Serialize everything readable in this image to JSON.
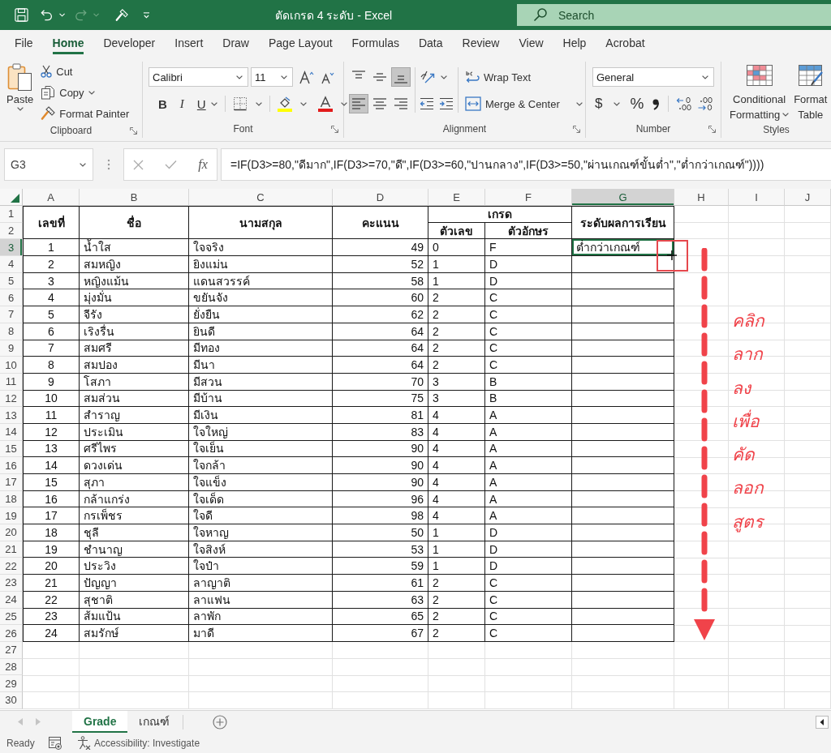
{
  "title_bar": {
    "title": "ตัดเกรด 4 ระดับ - Excel",
    "search": {
      "placeholder": "Search"
    }
  },
  "ribbon_tabs": [
    {
      "label": "File",
      "selected": false
    },
    {
      "label": "Home",
      "selected": true
    },
    {
      "label": "Developer",
      "selected": false
    },
    {
      "label": "Insert",
      "selected": false
    },
    {
      "label": "Draw",
      "selected": false
    },
    {
      "label": "Page Layout",
      "selected": false
    },
    {
      "label": "Formulas",
      "selected": false
    },
    {
      "label": "Data",
      "selected": false
    },
    {
      "label": "Review",
      "selected": false
    },
    {
      "label": "View",
      "selected": false
    },
    {
      "label": "Help",
      "selected": false
    },
    {
      "label": "Acrobat",
      "selected": false
    }
  ],
  "clipboard": {
    "paste": "Paste",
    "cut": "Cut",
    "copy": "Copy",
    "format_painter": "Format Painter",
    "group_label": "Clipboard"
  },
  "font": {
    "font_name": "Calibri",
    "font_size": "11",
    "styles": [
      {
        "kind": "bold",
        "label": "B"
      },
      {
        "kind": "italic",
        "label": "I"
      },
      {
        "kind": "underline",
        "label": "U"
      }
    ],
    "group_label": "Font"
  },
  "alignment": {
    "vertical": [
      {
        "kind": "top",
        "selected": false
      },
      {
        "kind": "middle",
        "selected": false
      },
      {
        "kind": "bottom",
        "selected": true
      }
    ],
    "horizontal": [
      {
        "kind": "left",
        "selected": true
      },
      {
        "kind": "center",
        "selected": false
      },
      {
        "kind": "right",
        "selected": false
      }
    ],
    "wrap_text": "Wrap Text",
    "merge_center": "Merge & Center",
    "group_label": "Alignment"
  },
  "number": {
    "format": "General",
    "currency": "$",
    "percent": "%",
    "group_label": "Number"
  },
  "styles": {
    "conditional_formatting": [
      "Conditional",
      "Formatting"
    ],
    "format_as_table": [
      "Format",
      "Table"
    ],
    "group_label": "Styles"
  },
  "formula_bar": {
    "name_box": "G3",
    "function_label": "fx",
    "formula": "=IF(D3>=80,\"ดีมาก\",IF(D3>=70,\"ดี\",IF(D3>=60,\"ปานกลาง\",IF(D3>=50,\"ผ่านเกณฑ์ขั้นต่ำ\",\"ต่ำกว่าเกณฑ์\"))))"
  },
  "sheet": {
    "columns": [
      {
        "label": "A",
        "selected": false
      },
      {
        "label": "B",
        "selected": false
      },
      {
        "label": "C",
        "selected": false
      },
      {
        "label": "D",
        "selected": false
      },
      {
        "label": "E",
        "selected": false
      },
      {
        "label": "F",
        "selected": false
      },
      {
        "label": "G",
        "selected": true
      },
      {
        "label": "H",
        "selected": false
      },
      {
        "label": "I",
        "selected": false
      },
      {
        "label": "J",
        "selected": false
      }
    ],
    "row_numbers": [
      {
        "label": "1",
        "selected": false
      },
      {
        "label": "2",
        "selected": false
      },
      {
        "label": "3",
        "selected": true
      },
      {
        "label": "4",
        "selected": false
      },
      {
        "label": "5",
        "selected": false
      },
      {
        "label": "6",
        "selected": false
      },
      {
        "label": "7",
        "selected": false
      },
      {
        "label": "8",
        "selected": false
      },
      {
        "label": "9",
        "selected": false
      },
      {
        "label": "10",
        "selected": false
      },
      {
        "label": "11",
        "selected": false
      },
      {
        "label": "12",
        "selected": false
      },
      {
        "label": "13",
        "selected": false
      },
      {
        "label": "14",
        "selected": false
      },
      {
        "label": "15",
        "selected": false
      },
      {
        "label": "16",
        "selected": false
      },
      {
        "label": "17",
        "selected": false
      },
      {
        "label": "18",
        "selected": false
      },
      {
        "label": "19",
        "selected": false
      },
      {
        "label": "20",
        "selected": false
      },
      {
        "label": "21",
        "selected": false
      },
      {
        "label": "22",
        "selected": false
      },
      {
        "label": "23",
        "selected": false
      },
      {
        "label": "24",
        "selected": false
      },
      {
        "label": "25",
        "selected": false
      },
      {
        "label": "26",
        "selected": false
      },
      {
        "label": "27",
        "selected": false
      },
      {
        "label": "28",
        "selected": false
      },
      {
        "label": "29",
        "selected": false
      },
      {
        "label": "30",
        "selected": false
      }
    ],
    "header": {
      "no": "เลขที่",
      "first_name": "ชื่อ",
      "last_name": "นามสกุล",
      "score": "คะแนน",
      "grade": "เกรด",
      "grade_number": "ตัวเลข",
      "grade_letter": "ตัวอักษร",
      "level": "ระดับผลการเรียน"
    },
    "rows": [
      {
        "no": "1",
        "first_name": "น้ำใส",
        "last_name": "ใจจริง",
        "score": "49",
        "grade_number": "0",
        "grade_letter": "F",
        "level": "ต่ำกว่าเกณฑ์"
      },
      {
        "no": "2",
        "first_name": "สมหญิง",
        "last_name": "ยิงแม่น",
        "score": "52",
        "grade_number": "1",
        "grade_letter": "D"
      },
      {
        "no": "3",
        "first_name": "หญิงแม้น",
        "last_name": "แดนสวรรค์",
        "score": "58",
        "grade_number": "1",
        "grade_letter": "D"
      },
      {
        "no": "4",
        "first_name": "มุ่งมั่น",
        "last_name": "ขยันจัง",
        "score": "60",
        "grade_number": "2",
        "grade_letter": "C"
      },
      {
        "no": "5",
        "first_name": "จีรัง",
        "last_name": "ยั่งยืน",
        "score": "62",
        "grade_number": "2",
        "grade_letter": "C"
      },
      {
        "no": "6",
        "first_name": "เริงรื่น",
        "last_name": "ยินดี",
        "score": "64",
        "grade_number": "2",
        "grade_letter": "C"
      },
      {
        "no": "7",
        "first_name": "สมศรี",
        "last_name": "มีทอง",
        "score": "64",
        "grade_number": "2",
        "grade_letter": "C"
      },
      {
        "no": "8",
        "first_name": "สมปอง",
        "last_name": "มีนา",
        "score": "64",
        "grade_number": "2",
        "grade_letter": "C"
      },
      {
        "no": "9",
        "first_name": "โสภา",
        "last_name": "มีสวน",
        "score": "70",
        "grade_number": "3",
        "grade_letter": "B"
      },
      {
        "no": "10",
        "first_name": "สมส่วน",
        "last_name": "มีบ้าน",
        "score": "75",
        "grade_number": "3",
        "grade_letter": "B"
      },
      {
        "no": "11",
        "first_name": "สำราญ",
        "last_name": "มีเงิน",
        "score": "81",
        "grade_number": "4",
        "grade_letter": "A"
      },
      {
        "no": "12",
        "first_name": "ประเมิน",
        "last_name": "ใจใหญ่",
        "score": "83",
        "grade_number": "4",
        "grade_letter": "A"
      },
      {
        "no": "13",
        "first_name": "ศรีไพร",
        "last_name": "ใจเย็น",
        "score": "90",
        "grade_number": "4",
        "grade_letter": "A"
      },
      {
        "no": "14",
        "first_name": "ดวงเด่น",
        "last_name": "ใจกล้า",
        "score": "90",
        "grade_number": "4",
        "grade_letter": "A"
      },
      {
        "no": "15",
        "first_name": "สุภา",
        "last_name": "ใจแข็ง",
        "score": "90",
        "grade_number": "4",
        "grade_letter": "A"
      },
      {
        "no": "16",
        "first_name": "กล้าแกร่ง",
        "last_name": "ใจเด็ด",
        "score": "96",
        "grade_number": "4",
        "grade_letter": "A"
      },
      {
        "no": "17",
        "first_name": "กรเพ็ชร",
        "last_name": "ใจดี",
        "score": "98",
        "grade_number": "4",
        "grade_letter": "A"
      },
      {
        "no": "18",
        "first_name": "ชุลี",
        "last_name": "ใจหาญ",
        "score": "50",
        "grade_number": "1",
        "grade_letter": "D"
      },
      {
        "no": "19",
        "first_name": "ชำนาญ",
        "last_name": "ใจสิงห์",
        "score": "53",
        "grade_number": "1",
        "grade_letter": "D"
      },
      {
        "no": "20",
        "first_name": "ประวิง",
        "last_name": "ใจป๋า",
        "score": "59",
        "grade_number": "1",
        "grade_letter": "D"
      },
      {
        "no": "21",
        "first_name": "ปัญญา",
        "last_name": "ลาญาติ",
        "score": "61",
        "grade_number": "2",
        "grade_letter": "C"
      },
      {
        "no": "22",
        "first_name": "สุชาติ",
        "last_name": "ลาแฟน",
        "score": "63",
        "grade_number": "2",
        "grade_letter": "C"
      },
      {
        "no": "23",
        "first_name": "ส้มแป้น",
        "last_name": "ลาพัก",
        "score": "65",
        "grade_number": "2",
        "grade_letter": "C"
      },
      {
        "no": "24",
        "first_name": "สมรักษ์",
        "last_name": "มาดี",
        "score": "67",
        "grade_number": "2",
        "grade_letter": "C"
      }
    ]
  },
  "annotation": {
    "lines": [
      "คลิก",
      "ลาก",
      "ลง",
      "เพื่อ",
      "คัด",
      "ลอก",
      "สูตร"
    ]
  },
  "sheet_tabs": [
    {
      "label": "Grade",
      "selected": true
    },
    {
      "label": "เกณฑ์",
      "selected": false
    }
  ],
  "status_bar": {
    "status": "Ready",
    "accessibility": "Accessibility: Investigate"
  }
}
